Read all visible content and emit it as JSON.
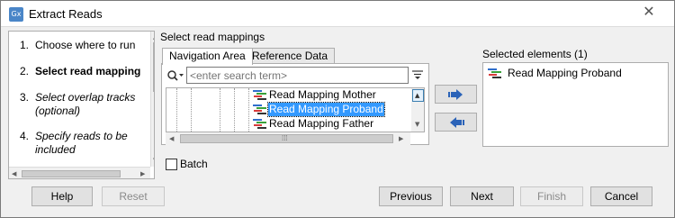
{
  "window": {
    "title": "Extract Reads",
    "app_icon": "Gx",
    "close_glyph": "✕"
  },
  "steps": [
    {
      "num": "1.",
      "label": "Choose where to run"
    },
    {
      "num": "2.",
      "label": "Select read mapping"
    },
    {
      "num": "3.",
      "label": "Select overlap tracks (optional)"
    },
    {
      "num": "4.",
      "label": "Specify reads to be included"
    }
  ],
  "main": {
    "heading": "Select read mappings",
    "tabs": [
      "Navigation Area",
      "Reference Data"
    ],
    "search_placeholder": "<enter search term>",
    "tree_items": [
      "Read Mapping Mother",
      "Read Mapping Proband",
      "Read Mapping Father"
    ],
    "selected_index": 1
  },
  "selected": {
    "heading": "Selected elements (1)",
    "items": [
      "Read Mapping Proband"
    ]
  },
  "batch_label": "Batch",
  "buttons": {
    "help": "Help",
    "reset": "Reset",
    "previous": "Previous",
    "next": "Next",
    "finish": "Finish",
    "cancel": "Cancel"
  },
  "colors": {
    "selection": "#3399ff",
    "move_arrow": "#2b63b8"
  },
  "icons": {
    "mapping": "read-mapping-icon",
    "search": "search-icon",
    "filter": "filter-icon"
  }
}
